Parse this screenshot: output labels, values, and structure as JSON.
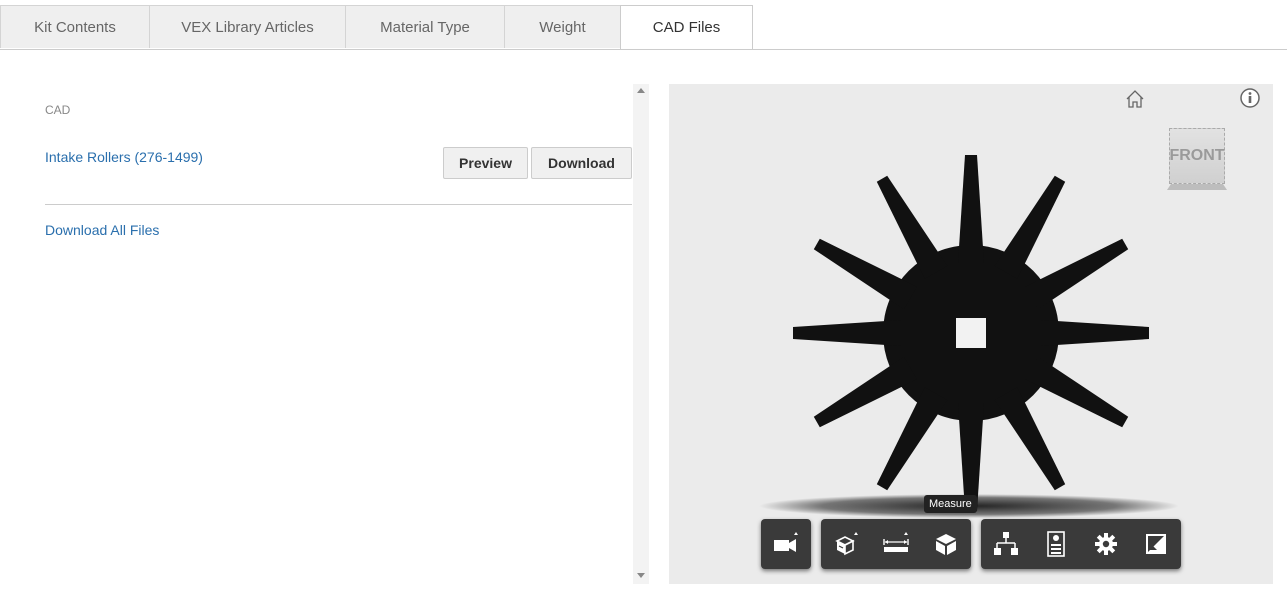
{
  "tabs": [
    {
      "label": "Kit Contents",
      "active": false
    },
    {
      "label": "VEX Library Articles",
      "active": false
    },
    {
      "label": "Material Type",
      "active": false
    },
    {
      "label": "Weight",
      "active": false
    },
    {
      "label": "CAD Files",
      "active": true
    }
  ],
  "cad_panel": {
    "section_label": "CAD",
    "file_name": "Intake Rollers (276-1499)",
    "preview_label": "Preview",
    "download_label": "Download",
    "download_all_label": "Download All Files"
  },
  "viewer": {
    "viewcube_label": "FRONT",
    "tooltip": "Measure",
    "toolbar": {
      "group1": [
        "camera-icon"
      ],
      "group2": [
        "explode-model-icon",
        "measure-icon",
        "section-cube-icon"
      ],
      "group3": [
        "model-browser-icon",
        "properties-icon",
        "settings-icon",
        "fullscreen-icon"
      ]
    },
    "colors": {
      "background": "#ebebeb",
      "model": "#111111",
      "toolbar": "#3a3a3a",
      "link": "#2a6fad"
    }
  }
}
